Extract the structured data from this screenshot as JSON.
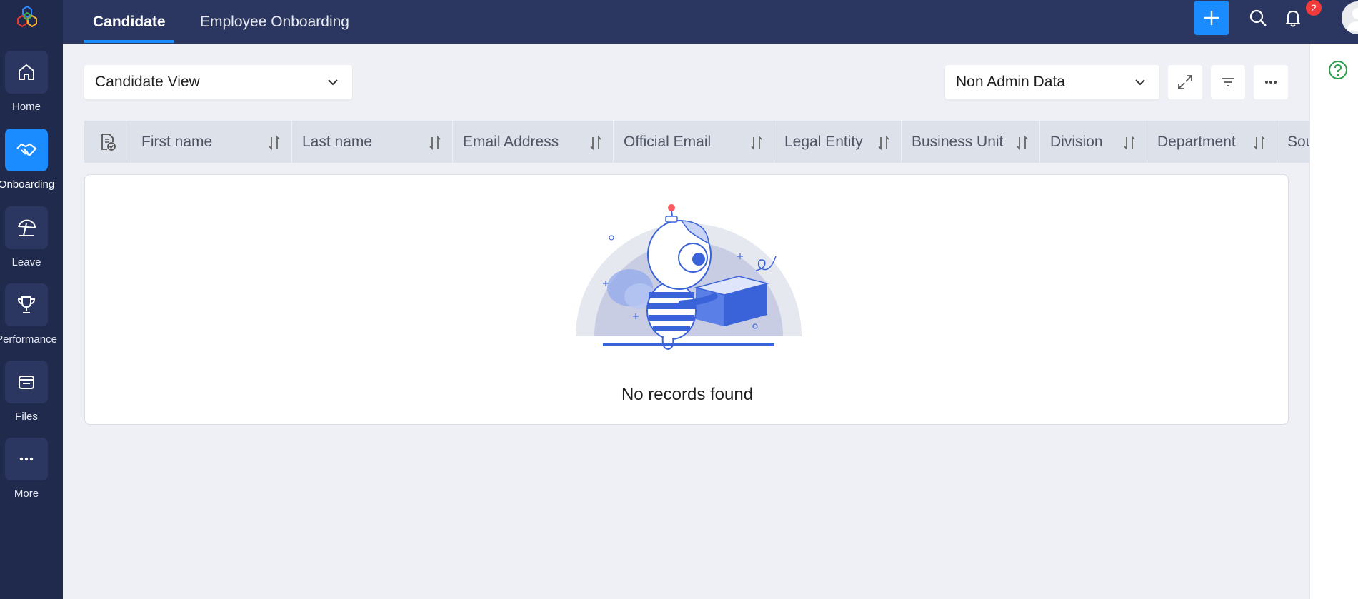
{
  "sidebar": {
    "items": [
      {
        "label": "Home",
        "icon": "home-icon",
        "active": false
      },
      {
        "label": "Onboarding",
        "icon": "handshake-icon",
        "active": true
      },
      {
        "label": "Leave",
        "icon": "umbrella-icon",
        "active": false
      },
      {
        "label": "Performance",
        "icon": "trophy-icon",
        "active": false
      },
      {
        "label": "Files",
        "icon": "folder-icon",
        "active": false
      },
      {
        "label": "More",
        "icon": "more-icon",
        "active": false
      }
    ]
  },
  "topbar": {
    "tabs": [
      {
        "label": "Candidate",
        "active": true
      },
      {
        "label": "Employee Onboarding",
        "active": false
      }
    ],
    "notification_count": "2"
  },
  "controls": {
    "view_select": "Candidate View",
    "data_select": "Non Admin Data"
  },
  "table": {
    "columns": [
      "First name",
      "Last name",
      "Email Address",
      "Official Email",
      "Legal Entity",
      "Business Unit",
      "Division",
      "Department",
      "Sou"
    ]
  },
  "empty_state": {
    "message": "No records found"
  },
  "colors": {
    "sidebar_bg": "#1f2a4d",
    "topbar_bg": "#2b3760",
    "accent": "#1a8cff",
    "badge": "#f23a3a"
  }
}
